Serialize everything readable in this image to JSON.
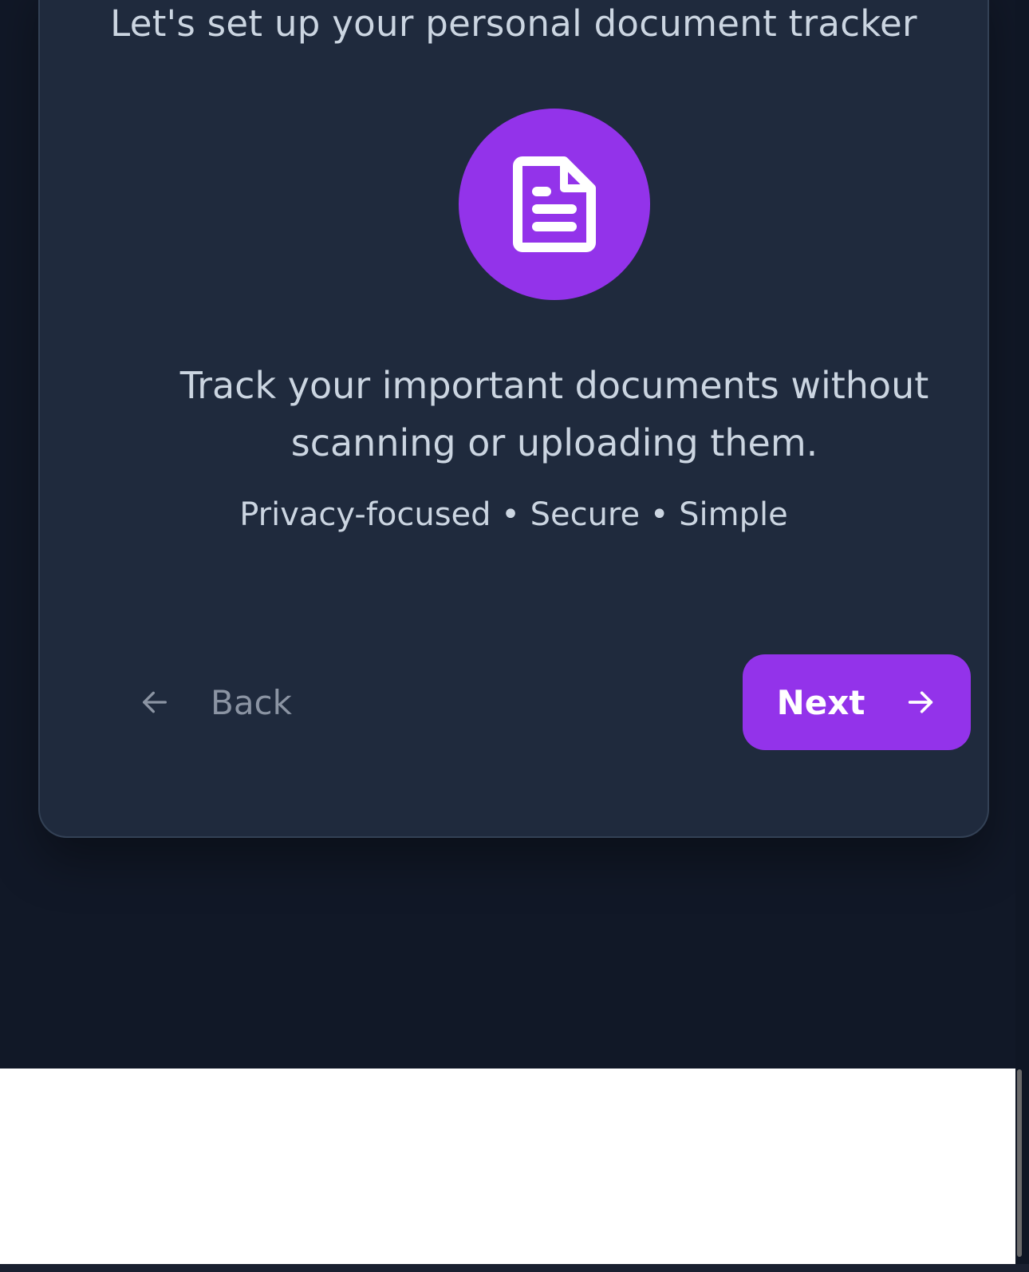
{
  "onboarding": {
    "subtitle": "Let's set up your personal document tracker",
    "icon": "document-icon",
    "tagline": "Track your important documents without scanning or uploading them.",
    "features": "Privacy-focused • Secure • Simple"
  },
  "navigation": {
    "back_label": "Back",
    "next_label": "Next"
  },
  "colors": {
    "background": "#111827",
    "card": "#1f2a3d",
    "accent": "#9333ea",
    "text": "#cbd5e1",
    "muted": "#8b94a3"
  }
}
